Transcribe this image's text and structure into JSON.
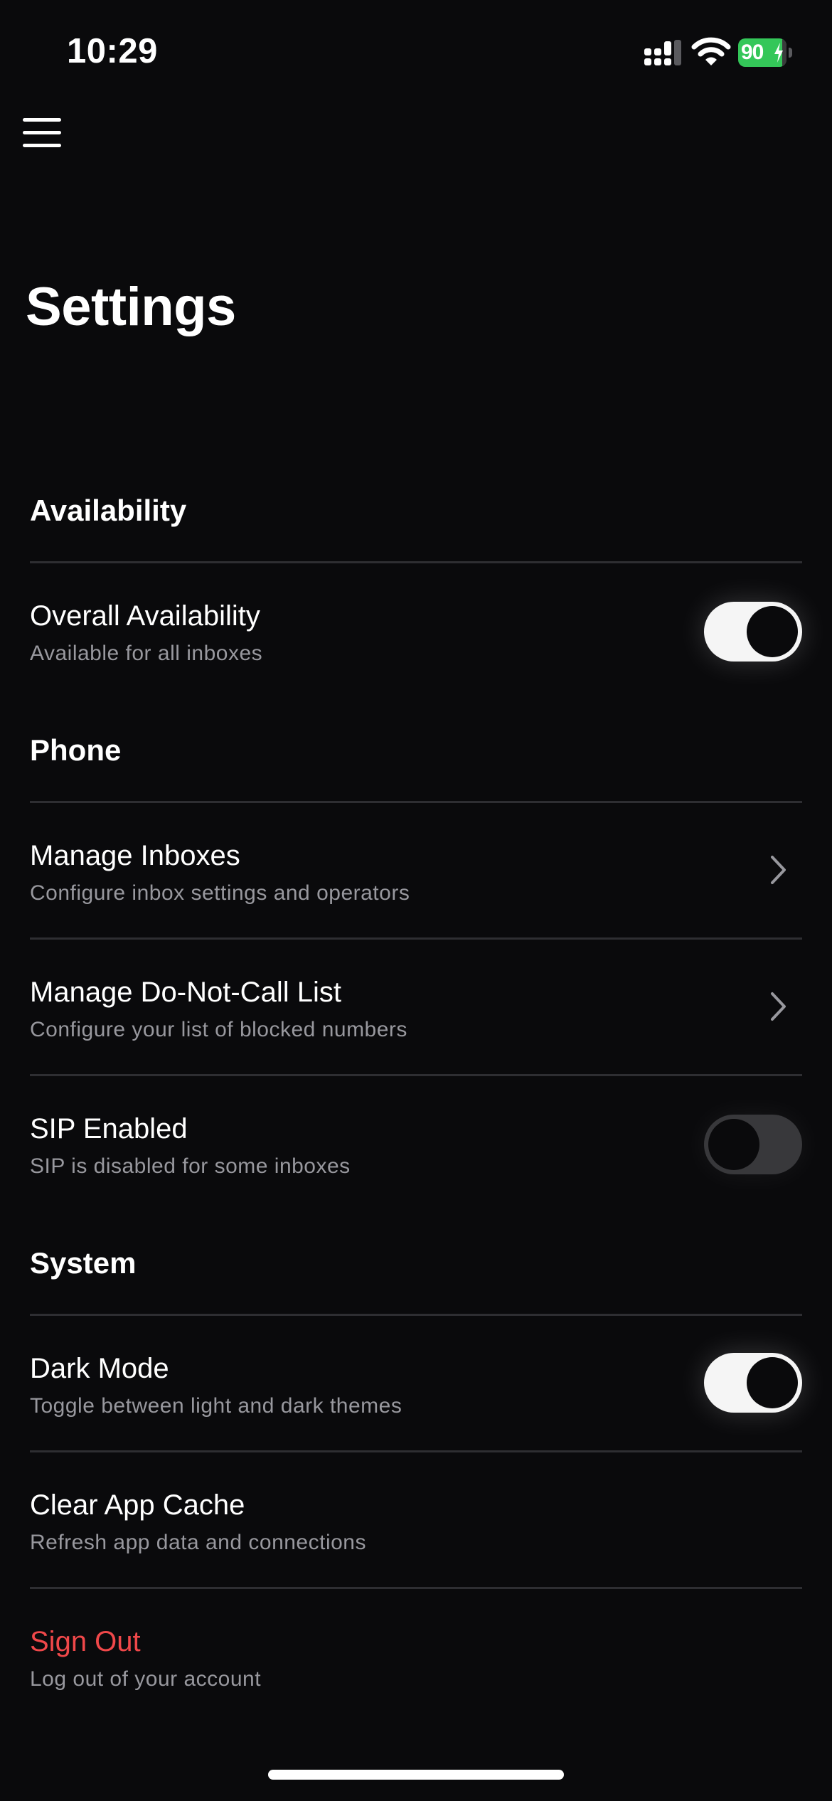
{
  "status_bar": {
    "time": "10:29",
    "battery_percent": "90"
  },
  "header": {
    "title": "Settings"
  },
  "sections": {
    "availability": {
      "title": "Availability",
      "overall": {
        "title": "Overall Availability",
        "subtitle": "Available for all inboxes",
        "enabled": true
      }
    },
    "phone": {
      "title": "Phone",
      "manage_inboxes": {
        "title": "Manage Inboxes",
        "subtitle": "Configure inbox settings and operators"
      },
      "manage_dnc": {
        "title": "Manage Do-Not-Call List",
        "subtitle": "Configure your list of blocked numbers"
      },
      "sip": {
        "title": "SIP Enabled",
        "subtitle": "SIP is disabled for some inboxes",
        "enabled": false
      }
    },
    "system": {
      "title": "System",
      "dark_mode": {
        "title": "Dark Mode",
        "subtitle": "Toggle between light and dark themes",
        "enabled": true
      },
      "clear_cache": {
        "title": "Clear App Cache",
        "subtitle": "Refresh app data and connections"
      },
      "sign_out": {
        "title": "Sign Out",
        "subtitle": "Log out of your account"
      }
    }
  },
  "colors": {
    "background": "#0a0a0c",
    "danger": "#f0484a",
    "battery": "#34c759",
    "subtitle": "#98989e",
    "divider": "#2e2e32"
  }
}
